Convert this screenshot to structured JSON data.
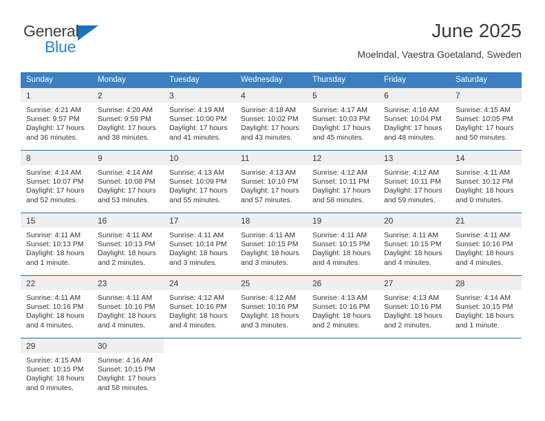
{
  "brand": {
    "line1": "General",
    "line2": "Blue",
    "triangle_color": "#1773ba",
    "line2_color": "#1f87d8"
  },
  "header": {
    "title": "June 2025",
    "subtitle": "Moelndal, Vaestra Goetaland, Sweden"
  },
  "theme": {
    "header_blue": "#3c7fc0",
    "row_divider_blue": "#1a6cae",
    "daynum_band": "#efefef"
  },
  "weekday_headers": [
    "Sunday",
    "Monday",
    "Tuesday",
    "Wednesday",
    "Thursday",
    "Friday",
    "Saturday"
  ],
  "weeks": [
    [
      {
        "day": "1",
        "sunrise": "Sunrise: 4:21 AM",
        "sunset": "Sunset: 9:57 PM",
        "daylight1": "Daylight: 17 hours",
        "daylight2": "and 36 minutes."
      },
      {
        "day": "2",
        "sunrise": "Sunrise: 4:20 AM",
        "sunset": "Sunset: 9:59 PM",
        "daylight1": "Daylight: 17 hours",
        "daylight2": "and 38 minutes."
      },
      {
        "day": "3",
        "sunrise": "Sunrise: 4:19 AM",
        "sunset": "Sunset: 10:00 PM",
        "daylight1": "Daylight: 17 hours",
        "daylight2": "and 41 minutes."
      },
      {
        "day": "4",
        "sunrise": "Sunrise: 4:18 AM",
        "sunset": "Sunset: 10:02 PM",
        "daylight1": "Daylight: 17 hours",
        "daylight2": "and 43 minutes."
      },
      {
        "day": "5",
        "sunrise": "Sunrise: 4:17 AM",
        "sunset": "Sunset: 10:03 PM",
        "daylight1": "Daylight: 17 hours",
        "daylight2": "and 45 minutes."
      },
      {
        "day": "6",
        "sunrise": "Sunrise: 4:16 AM",
        "sunset": "Sunset: 10:04 PM",
        "daylight1": "Daylight: 17 hours",
        "daylight2": "and 48 minutes."
      },
      {
        "day": "7",
        "sunrise": "Sunrise: 4:15 AM",
        "sunset": "Sunset: 10:05 PM",
        "daylight1": "Daylight: 17 hours",
        "daylight2": "and 50 minutes."
      }
    ],
    [
      {
        "day": "8",
        "sunrise": "Sunrise: 4:14 AM",
        "sunset": "Sunset: 10:07 PM",
        "daylight1": "Daylight: 17 hours",
        "daylight2": "and 52 minutes."
      },
      {
        "day": "9",
        "sunrise": "Sunrise: 4:14 AM",
        "sunset": "Sunset: 10:08 PM",
        "daylight1": "Daylight: 17 hours",
        "daylight2": "and 53 minutes."
      },
      {
        "day": "10",
        "sunrise": "Sunrise: 4:13 AM",
        "sunset": "Sunset: 10:09 PM",
        "daylight1": "Daylight: 17 hours",
        "daylight2": "and 55 minutes."
      },
      {
        "day": "11",
        "sunrise": "Sunrise: 4:13 AM",
        "sunset": "Sunset: 10:10 PM",
        "daylight1": "Daylight: 17 hours",
        "daylight2": "and 57 minutes."
      },
      {
        "day": "12",
        "sunrise": "Sunrise: 4:12 AM",
        "sunset": "Sunset: 10:11 PM",
        "daylight1": "Daylight: 17 hours",
        "daylight2": "and 58 minutes."
      },
      {
        "day": "13",
        "sunrise": "Sunrise: 4:12 AM",
        "sunset": "Sunset: 10:11 PM",
        "daylight1": "Daylight: 17 hours",
        "daylight2": "and 59 minutes."
      },
      {
        "day": "14",
        "sunrise": "Sunrise: 4:11 AM",
        "sunset": "Sunset: 10:12 PM",
        "daylight1": "Daylight: 18 hours",
        "daylight2": "and 0 minutes."
      }
    ],
    [
      {
        "day": "15",
        "sunrise": "Sunrise: 4:11 AM",
        "sunset": "Sunset: 10:13 PM",
        "daylight1": "Daylight: 18 hours",
        "daylight2": "and 1 minute."
      },
      {
        "day": "16",
        "sunrise": "Sunrise: 4:11 AM",
        "sunset": "Sunset: 10:13 PM",
        "daylight1": "Daylight: 18 hours",
        "daylight2": "and 2 minutes."
      },
      {
        "day": "17",
        "sunrise": "Sunrise: 4:11 AM",
        "sunset": "Sunset: 10:14 PM",
        "daylight1": "Daylight: 18 hours",
        "daylight2": "and 3 minutes."
      },
      {
        "day": "18",
        "sunrise": "Sunrise: 4:11 AM",
        "sunset": "Sunset: 10:15 PM",
        "daylight1": "Daylight: 18 hours",
        "daylight2": "and 3 minutes."
      },
      {
        "day": "19",
        "sunrise": "Sunrise: 4:11 AM",
        "sunset": "Sunset: 10:15 PM",
        "daylight1": "Daylight: 18 hours",
        "daylight2": "and 4 minutes."
      },
      {
        "day": "20",
        "sunrise": "Sunrise: 4:11 AM",
        "sunset": "Sunset: 10:15 PM",
        "daylight1": "Daylight: 18 hours",
        "daylight2": "and 4 minutes."
      },
      {
        "day": "21",
        "sunrise": "Sunrise: 4:11 AM",
        "sunset": "Sunset: 10:16 PM",
        "daylight1": "Daylight: 18 hours",
        "daylight2": "and 4 minutes."
      }
    ],
    [
      {
        "day": "22",
        "sunrise": "Sunrise: 4:11 AM",
        "sunset": "Sunset: 10:16 PM",
        "daylight1": "Daylight: 18 hours",
        "daylight2": "and 4 minutes."
      },
      {
        "day": "23",
        "sunrise": "Sunrise: 4:11 AM",
        "sunset": "Sunset: 10:16 PM",
        "daylight1": "Daylight: 18 hours",
        "daylight2": "and 4 minutes."
      },
      {
        "day": "24",
        "sunrise": "Sunrise: 4:12 AM",
        "sunset": "Sunset: 10:16 PM",
        "daylight1": "Daylight: 18 hours",
        "daylight2": "and 4 minutes."
      },
      {
        "day": "25",
        "sunrise": "Sunrise: 4:12 AM",
        "sunset": "Sunset: 10:16 PM",
        "daylight1": "Daylight: 18 hours",
        "daylight2": "and 3 minutes."
      },
      {
        "day": "26",
        "sunrise": "Sunrise: 4:13 AM",
        "sunset": "Sunset: 10:16 PM",
        "daylight1": "Daylight: 18 hours",
        "daylight2": "and 2 minutes."
      },
      {
        "day": "27",
        "sunrise": "Sunrise: 4:13 AM",
        "sunset": "Sunset: 10:16 PM",
        "daylight1": "Daylight: 18 hours",
        "daylight2": "and 2 minutes."
      },
      {
        "day": "28",
        "sunrise": "Sunrise: 4:14 AM",
        "sunset": "Sunset: 10:15 PM",
        "daylight1": "Daylight: 18 hours",
        "daylight2": "and 1 minute."
      }
    ],
    [
      {
        "day": "29",
        "sunrise": "Sunrise: 4:15 AM",
        "sunset": "Sunset: 10:15 PM",
        "daylight1": "Daylight: 18 hours",
        "daylight2": "and 0 minutes."
      },
      {
        "day": "30",
        "sunrise": "Sunrise: 4:16 AM",
        "sunset": "Sunset: 10:15 PM",
        "daylight1": "Daylight: 17 hours",
        "daylight2": "and 58 minutes."
      },
      {
        "day": "",
        "sunrise": "",
        "sunset": "",
        "daylight1": "",
        "daylight2": ""
      },
      {
        "day": "",
        "sunrise": "",
        "sunset": "",
        "daylight1": "",
        "daylight2": ""
      },
      {
        "day": "",
        "sunrise": "",
        "sunset": "",
        "daylight1": "",
        "daylight2": ""
      },
      {
        "day": "",
        "sunrise": "",
        "sunset": "",
        "daylight1": "",
        "daylight2": ""
      },
      {
        "day": "",
        "sunrise": "",
        "sunset": "",
        "daylight1": "",
        "daylight2": ""
      }
    ]
  ]
}
